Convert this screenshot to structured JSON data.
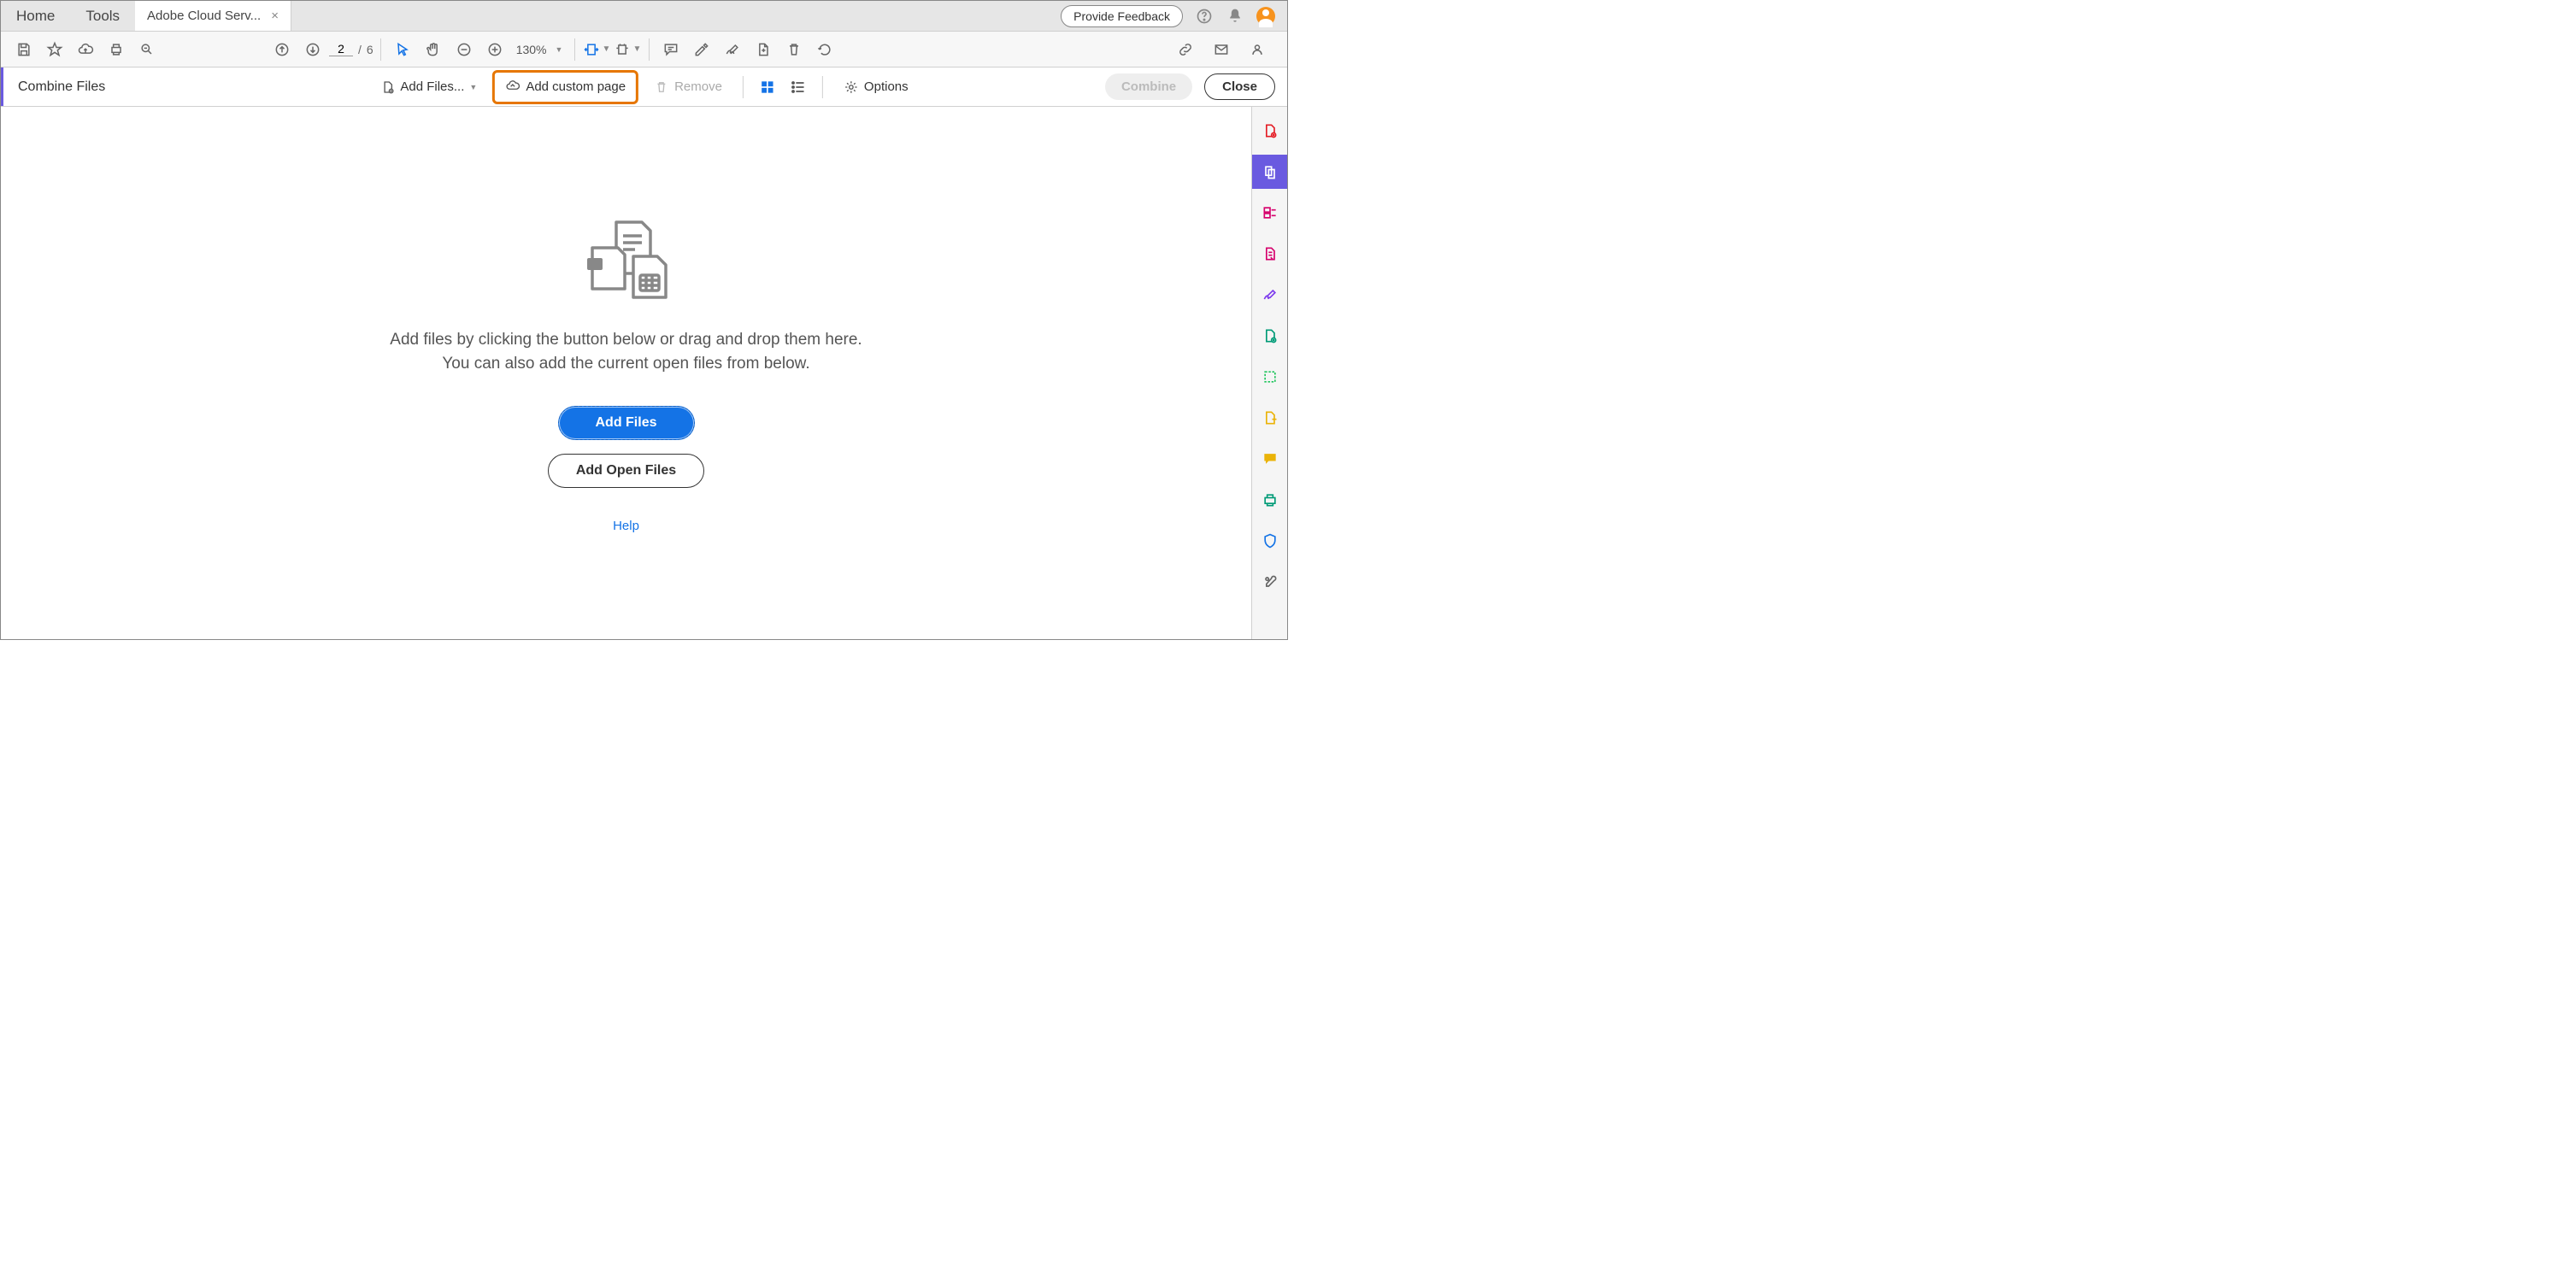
{
  "tabs": {
    "home": "Home",
    "tools": "Tools",
    "doc": "Adobe Cloud Serv..."
  },
  "topright": {
    "feedback": "Provide Feedback"
  },
  "toolbar": {
    "page_current": "2",
    "page_sep": "/",
    "page_total": "6",
    "zoom": "130%"
  },
  "combine": {
    "title": "Combine Files",
    "add_files": "Add Files...",
    "add_custom_page": "Add custom page",
    "remove": "Remove",
    "options": "Options",
    "combine_btn": "Combine",
    "close_btn": "Close"
  },
  "empty": {
    "line1": "Add files by clicking the button below or drag and drop them here.",
    "line2": "You can also add the current open files from below.",
    "add_files_btn": "Add Files",
    "add_open_files_btn": "Add Open Files",
    "help": "Help"
  }
}
